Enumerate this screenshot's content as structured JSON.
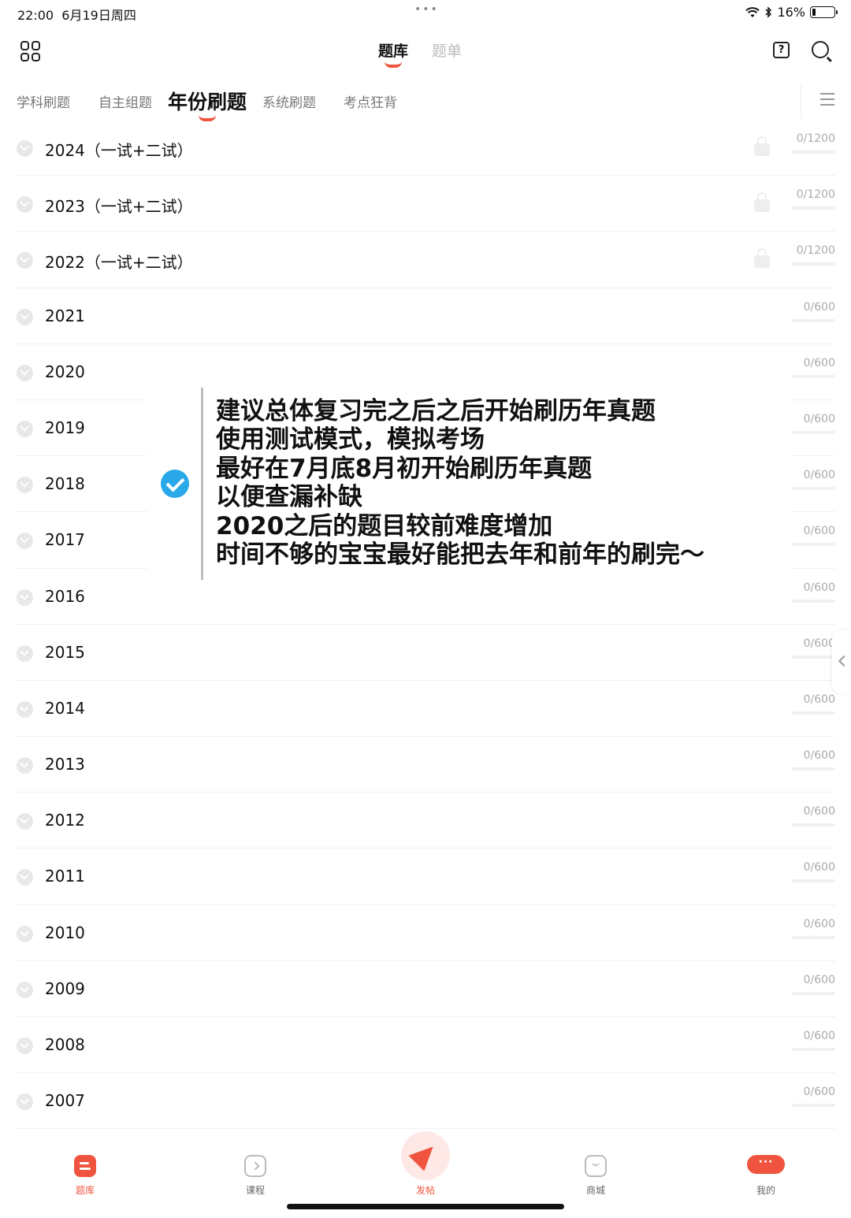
{
  "status_bar": {
    "time": "22:00",
    "date": "6月19日周四",
    "dots": "•••",
    "battery_text": "16%",
    "battery_level": 0.16,
    "bluetooth_icon": "bluetooth-icon",
    "wifi_icon": "wifi-icon"
  },
  "header": {
    "tabs": [
      {
        "label": "题库",
        "active": true
      },
      {
        "label": "题单",
        "active": false
      }
    ],
    "grid_icon": "grid-icon",
    "help_icon_text": "?",
    "search_icon": "search-icon"
  },
  "category_tabs": [
    {
      "label": "学科刷题"
    },
    {
      "label": "自主组题"
    },
    {
      "label": "年份刷题",
      "active": true
    },
    {
      "label": "系统刷题"
    },
    {
      "label": "考点狂背"
    }
  ],
  "years": [
    {
      "label": "2024（一试+二试）",
      "progress": "0/1200",
      "locked": true
    },
    {
      "label": "2023（一试+二试）",
      "progress": "0/1200",
      "locked": true
    },
    {
      "label": "2022（一试+二试）",
      "progress": "0/1200",
      "locked": true
    },
    {
      "label": "2021",
      "progress": "0/600"
    },
    {
      "label": "2020",
      "progress": "0/600"
    },
    {
      "label": "2019",
      "progress": "0/600"
    },
    {
      "label": "2018",
      "progress": "0/600"
    },
    {
      "label": "2017",
      "progress": "0/600"
    },
    {
      "label": "2016",
      "progress": "0/600"
    },
    {
      "label": "2015",
      "progress": "0/600"
    },
    {
      "label": "2014",
      "progress": "0/600"
    },
    {
      "label": "2013",
      "progress": "0/600"
    },
    {
      "label": "2012",
      "progress": "0/600"
    },
    {
      "label": "2011",
      "progress": "0/600"
    },
    {
      "label": "2010",
      "progress": "0/600"
    },
    {
      "label": "2009",
      "progress": "0/600"
    },
    {
      "label": "2008",
      "progress": "0/600"
    },
    {
      "label": "2007",
      "progress": "0/600"
    }
  ],
  "note": {
    "lines": [
      "建议总体复习完之后之后开始刷历年真题",
      "使用测试模式，模拟考场",
      "最好在7月底8月初开始刷历年真题",
      "以便查漏补缺",
      "2020之后的题目较前难度增加",
      "时间不够的宝宝最好能把去年和前年的刷完～"
    ],
    "check_color": "#29a8ea"
  },
  "bottom_nav": [
    {
      "label": "题库",
      "icon": "question-bank-icon",
      "active": true
    },
    {
      "label": "课程",
      "icon": "course-icon"
    },
    {
      "label": "发帖",
      "icon": "paper-plane-icon"
    },
    {
      "label": "商城",
      "icon": "shop-bag-icon"
    },
    {
      "label": "我的",
      "icon": "chat-bubble-icon",
      "bubble_text": "···"
    }
  ],
  "colors": {
    "accent": "#f0543e",
    "muted_text": "#aaaaaa",
    "primary_text": "#111111"
  }
}
